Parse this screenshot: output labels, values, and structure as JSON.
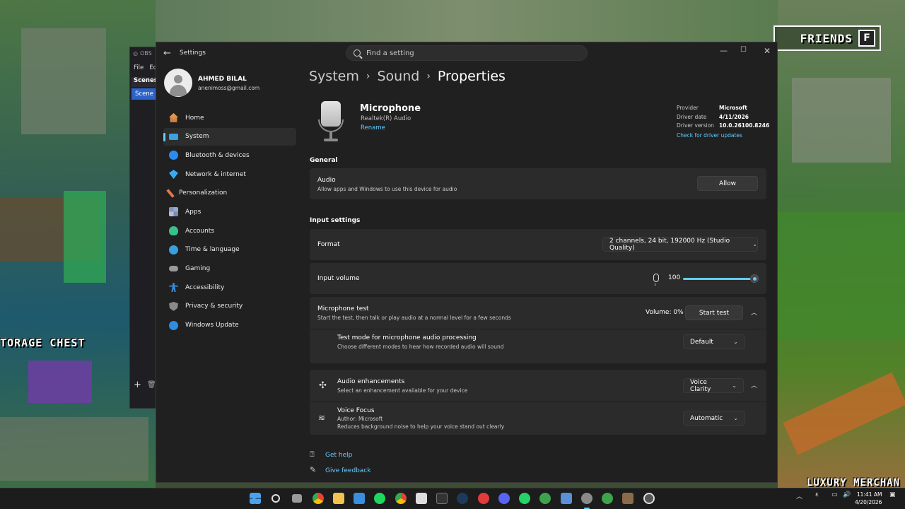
{
  "background": {
    "storage_label": "TORAGE CHEST",
    "merchant_label": "LUXURY MERCHAN",
    "friends_badge": "FRIENDS",
    "friends_key": "F"
  },
  "obs": {
    "title": "OBS",
    "menu": [
      "File",
      "Ed"
    ],
    "scenes_header": "Scenes",
    "scene_item": "Scene"
  },
  "window": {
    "title": "Settings",
    "search_placeholder": "Find a setting"
  },
  "user": {
    "name": "AHMED BILAL",
    "email": "anenimoss@gmail.com"
  },
  "nav": [
    {
      "label": "Home",
      "icon": "home-icon"
    },
    {
      "label": "System",
      "icon": "system-icon",
      "active": true
    },
    {
      "label": "Bluetooth & devices",
      "icon": "bluetooth-icon"
    },
    {
      "label": "Network & internet",
      "icon": "network-icon"
    },
    {
      "label": "Personalization",
      "icon": "personalization-icon"
    },
    {
      "label": "Apps",
      "icon": "apps-icon"
    },
    {
      "label": "Accounts",
      "icon": "accounts-icon"
    },
    {
      "label": "Time & language",
      "icon": "time-language-icon"
    },
    {
      "label": "Gaming",
      "icon": "gaming-icon"
    },
    {
      "label": "Accessibility",
      "icon": "accessibility-icon"
    },
    {
      "label": "Privacy & security",
      "icon": "privacy-security-icon"
    },
    {
      "label": "Windows Update",
      "icon": "windows-update-icon"
    }
  ],
  "breadcrumb": {
    "level1": "System",
    "level2": "Sound",
    "current": "Properties"
  },
  "device": {
    "name": "Microphone",
    "driver": "Realtek(R) Audio",
    "rename": "Rename",
    "provider_label": "Provider",
    "provider": "Microsoft",
    "driver_date_label": "Driver date",
    "driver_date": "4/11/2026",
    "driver_version_label": "Driver version",
    "driver_version": "10.0.26100.8246",
    "check_updates": "Check for driver updates"
  },
  "general": {
    "header": "General",
    "audio_title": "Audio",
    "audio_sub": "Allow apps and Windows to use this device for audio",
    "allow_button": "Allow"
  },
  "input_settings": {
    "header": "Input settings",
    "format_label": "Format",
    "format_value": "2 channels, 24 bit, 192000 Hz (Studio Quality)",
    "input_volume_label": "Input volume",
    "input_volume_value": "100",
    "input_volume_level": 1.0,
    "mic_test_title": "Microphone test",
    "mic_test_sub": "Start the test, then talk or play audio at a normal level for a few seconds",
    "mic_test_volume": "Volume: 0%",
    "start_test": "Start test",
    "test_mode_title": "Test mode for microphone audio processing",
    "test_mode_sub": "Choose different modes to hear how recorded audio will sound",
    "test_mode_value": "Default"
  },
  "enhancements": {
    "title": "Audio enhancements",
    "sub": "Select an enhancement available for your device",
    "value": "Voice Clarity",
    "voice_focus_title": "Voice Focus",
    "voice_focus_author": "Author: Microsoft",
    "voice_focus_sub": "Reduces background noise to help your voice stand out clearly",
    "voice_focus_value": "Automatic"
  },
  "help": {
    "get_help": "Get help",
    "give_feedback": "Give feedback"
  },
  "taskbar": {
    "time": "11:41 AM",
    "date": "4/20/2026",
    "lang": "ε"
  },
  "colors": {
    "accent": "#60cdff",
    "window_bg": "#202020",
    "card_bg": "#2b2b2b"
  }
}
